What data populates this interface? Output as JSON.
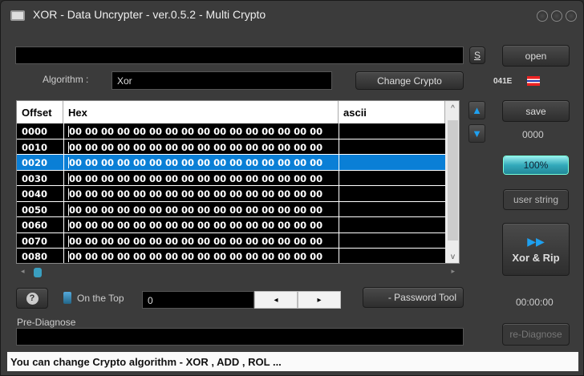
{
  "window": {
    "title": "XOR - Data Uncrypter - ver.0.5.2 - Multi Crypto"
  },
  "path": {
    "value": "",
    "s_button": "S"
  },
  "buttons": {
    "open": "open",
    "save": "save",
    "change_crypto": "Change Crypto",
    "user_string": "user string",
    "xor_rip": "Xor & Rip",
    "password_tool": "- Password Tool",
    "re_diagnose": "re-Diagnose",
    "help": "?"
  },
  "algorithm": {
    "label": "Algorithm  :",
    "value": "Xor"
  },
  "locale": {
    "code": "041E"
  },
  "table": {
    "headers": [
      "Offset",
      "Hex",
      "ascii"
    ],
    "rows": [
      {
        "offset": "0000",
        "hex": "00 00 00 00 00 00 00 00 00 00 00 00 00 00 00 00",
        "ascii": ""
      },
      {
        "offset": "0010",
        "hex": "00 00 00 00 00 00 00 00 00 00 00 00 00 00 00 00",
        "ascii": ""
      },
      {
        "offset": "0020",
        "hex": "00 00 00 00 00 00 00 00 00 00 00 00 00 00 00 00",
        "ascii": ""
      },
      {
        "offset": "0030",
        "hex": "00 00 00 00 00 00 00 00 00 00 00 00 00 00 00 00",
        "ascii": ""
      },
      {
        "offset": "0040",
        "hex": "00 00 00 00 00 00 00 00 00 00 00 00 00 00 00 00",
        "ascii": ""
      },
      {
        "offset": "0050",
        "hex": "00 00 00 00 00 00 00 00 00 00 00 00 00 00 00 00",
        "ascii": ""
      },
      {
        "offset": "0060",
        "hex": "00 00 00 00 00 00 00 00 00 00 00 00 00 00 00 00",
        "ascii": ""
      },
      {
        "offset": "0070",
        "hex": "00 00 00 00 00 00 00 00 00 00 00 00 00 00 00 00",
        "ascii": ""
      },
      {
        "offset": "0080",
        "hex": "00 00 00 00 00 00 00 00 00 00 00 00 00 00 00 00",
        "ascii": ""
      }
    ],
    "selected_index": 2
  },
  "counter": "0000",
  "progress": {
    "label": "100%",
    "percent": 100
  },
  "on_top": {
    "label": "On the Top"
  },
  "number": {
    "value": "0",
    "left": "◂",
    "right": "▸"
  },
  "timer": "00:00:00",
  "pre_diagnose": {
    "label": "Pre-Diagnose",
    "value": ""
  },
  "status": "You can change Crypto algorithm - XOR , ADD , ROL ..."
}
